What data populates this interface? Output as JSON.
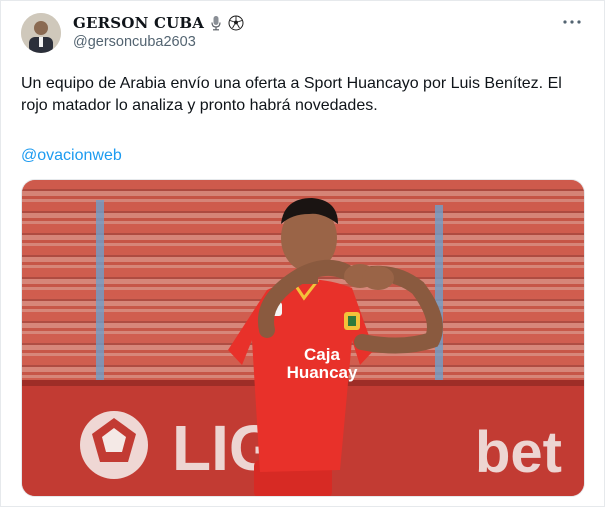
{
  "author": {
    "display_name": "GERSON CUBA",
    "handle": "@gersoncuba2603",
    "badges": [
      "microphone-icon",
      "soccer-ball-icon"
    ]
  },
  "tweet": {
    "text": "Un equipo de Arabia envío una oferta a Sport Huancayo por Luis Benítez. El rojo matador lo analiza y pronto habrá novedades.",
    "mention": "@ovacionweb"
  },
  "media": {
    "description_icon": "photo",
    "jersey_sponsor_line1": "Caja",
    "jersey_sponsor_line2": "Huancay",
    "board_left": "LIG",
    "board_right": "bet"
  },
  "colors": {
    "link": "#1d9bf0",
    "secondary_text": "#536471",
    "jersey_red": "#e8312a",
    "seat_red": "#d9473f"
  }
}
